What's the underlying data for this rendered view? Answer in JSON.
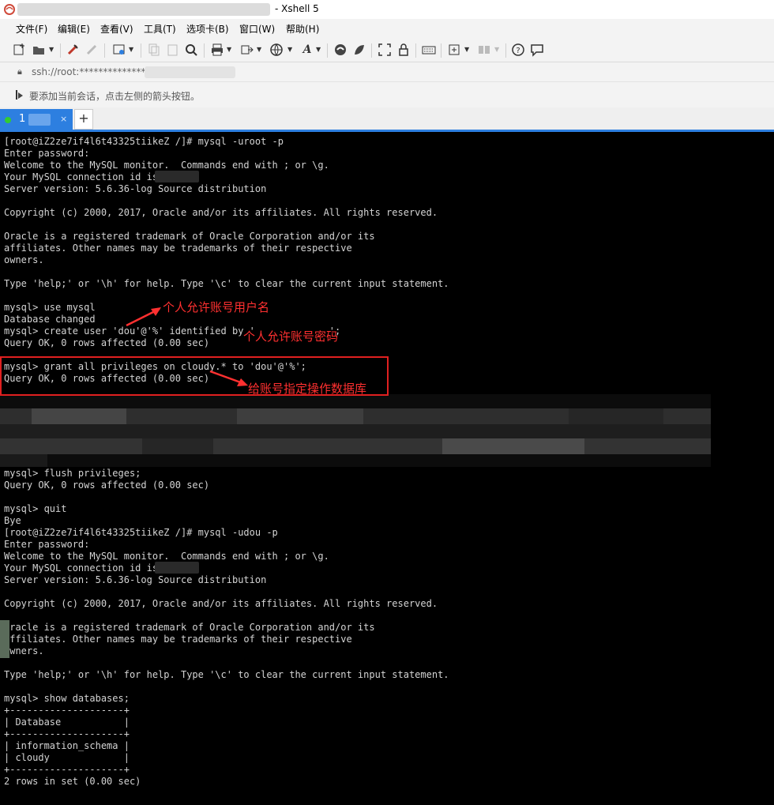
{
  "window": {
    "title": "- Xshell 5"
  },
  "menu": [
    "文件(F)",
    "编辑(E)",
    "查看(V)",
    "工具(T)",
    "选项卡(B)",
    "窗口(W)",
    "帮助(H)"
  ],
  "toolbar_icons": [
    "new-session-icon",
    "open-folder-icon",
    "dropdown",
    "reconnect-icon",
    "disconnect-icon",
    "properties-icon",
    "dropdown",
    "copy-icon",
    "paste-icon",
    "find-icon",
    "print-icon",
    "dropdown",
    "transfer-icon",
    "dropdown",
    "globe-icon",
    "dropdown",
    "font-icon",
    "dropdown",
    "xftp-icon",
    "xmanager-icon",
    "fullscreen-icon",
    "lock-icon",
    "keyboard-icon",
    "compose-icon",
    "dropdown",
    "layout-icon",
    "dropdown",
    "help-icon",
    "chat-icon"
  ],
  "address": {
    "text": "ssh://root:**************@"
  },
  "hint": {
    "text": "要添加当前会话，点击左侧的箭头按钮。"
  },
  "tab": {
    "number": "1",
    "close": "×",
    "new": "+"
  },
  "terminal": {
    "lines": [
      "[root@iZ2ze7if4l6t43325tiikeZ /]# mysql -uroot -p",
      "Enter password:",
      "Welcome to the MySQL monitor.  Commands end with ; or \\g.",
      "Your MySQL connection id is",
      "Server version: 5.6.36-log Source distribution",
      "",
      "Copyright (c) 2000, 2017, Oracle and/or its affiliates. All rights reserved.",
      "",
      "Oracle is a registered trademark of Oracle Corporation and/or its",
      "affiliates. Other names may be trademarks of their respective",
      "owners.",
      "",
      "Type 'help;' or '\\h' for help. Type '\\c' to clear the current input statement.",
      "",
      "mysql> use mysql",
      "Database changed",
      "mysql> create user 'dou'@'%' identified by '             ';",
      "Query OK, 0 rows affected (0.00 sec)",
      "",
      "mysql> grant all privileges on cloudy.* to 'dou'@'%';",
      "Query OK, 0 rows affected (0.00 sec)",
      "",
      "",
      "",
      "",
      "",
      "",
      "",
      "mysql> flush privileges;",
      "Query OK, 0 rows affected (0.00 sec)",
      "",
      "mysql> quit",
      "Bye",
      "[root@iZ2ze7if4l6t43325tiikeZ /]# mysql -udou -p",
      "Enter password:",
      "Welcome to the MySQL monitor.  Commands end with ; or \\g.",
      "Your MySQL connection id is",
      "Server version: 5.6.36-log Source distribution",
      "",
      "Copyright (c) 2000, 2017, Oracle and/or its affiliates. All rights reserved.",
      "",
      "Oracle is a registered trademark of Oracle Corporation and/or its",
      "affiliates. Other names may be trademarks of their respective",
      "owners.",
      "",
      "Type 'help;' or '\\h' for help. Type '\\c' to clear the current input statement.",
      "",
      "mysql> show databases;",
      "+--------------------+",
      "| Database           |",
      "+--------------------+",
      "| information_schema |",
      "| cloudy             |",
      "+--------------------+",
      "2 rows in set (0.00 sec)"
    ]
  },
  "annotations": {
    "username": "个人允许账号用户名",
    "password": "个人允许账号密码",
    "database": "给账号指定操作数据库"
  },
  "colors": {
    "annotation": "#ff3030",
    "tab_accent": "#2d7fe0",
    "terminal_bg": "#000000",
    "terminal_fg": "#d4d4d4"
  }
}
